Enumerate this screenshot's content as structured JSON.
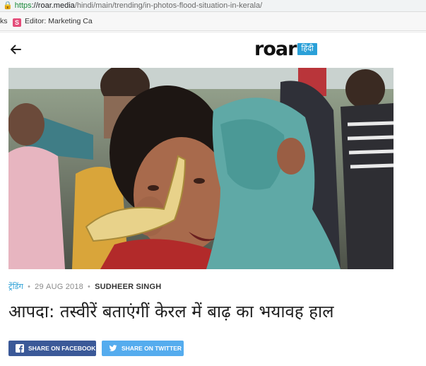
{
  "browser": {
    "url_scheme": "https",
    "url_rest": "://",
    "url_domain": "roar.media",
    "url_path": "/hindi/main/trending/in-photos-flood-situation-in-kerala/",
    "bookmarks_cut_label": "ks",
    "bookmark_label": "Editor: Marketing Ca",
    "bookmark_icon_letter": "S"
  },
  "header": {
    "logo_text": "roar",
    "logo_badge": "हिंदी"
  },
  "article": {
    "category": "ट्रेंडिंग",
    "date": "29 AUG 2018",
    "author": "SUDHEER SINGH",
    "headline": "आपदा: तस्वीरें बताएंगीं केरल में बाढ़ का भयावह हाल"
  },
  "share": {
    "facebook_label": "SHARE ON FACEBOOK",
    "twitter_label": "SHARE ON TWITTER"
  },
  "colors": {
    "accent": "#2aa0d8",
    "facebook": "#3b5998",
    "twitter": "#55acee"
  }
}
